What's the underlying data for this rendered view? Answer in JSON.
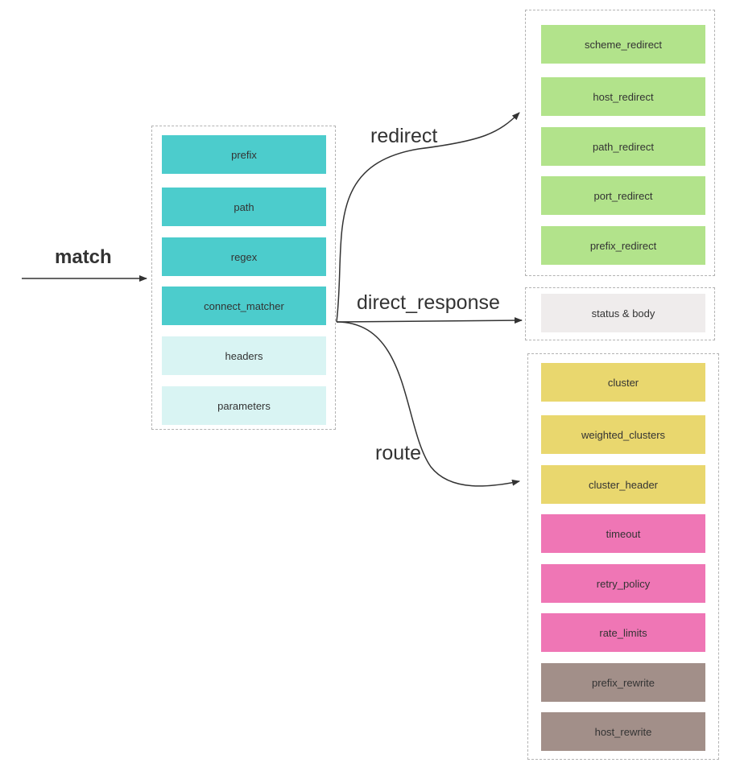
{
  "colors": {
    "teal": "#4ccccc",
    "light_teal": "#d9f4f3",
    "green": "#b2e38b",
    "gray": "#efecec",
    "yellow": "#e9d76e",
    "pink": "#ef76b5",
    "taupe": "#a28f89",
    "arrow": "#333333"
  },
  "match": {
    "label": "match",
    "items": [
      {
        "label": "prefix",
        "color": "#4ccccc"
      },
      {
        "label": "path",
        "color": "#4ccccc"
      },
      {
        "label": "regex",
        "color": "#4ccccc"
      },
      {
        "label": "connect_matcher",
        "color": "#4ccccc"
      },
      {
        "label": "headers",
        "color": "#d9f4f3"
      },
      {
        "label": "parameters",
        "color": "#d9f4f3"
      }
    ]
  },
  "edges": {
    "redirect": "redirect",
    "direct_response": "direct_response",
    "route": "route"
  },
  "redirect": {
    "items": [
      {
        "label": "scheme_redirect",
        "color": "#b2e38b"
      },
      {
        "label": "host_redirect",
        "color": "#b2e38b"
      },
      {
        "label": "path_redirect",
        "color": "#b2e38b"
      },
      {
        "label": "port_redirect",
        "color": "#b2e38b"
      },
      {
        "label": "prefix_redirect",
        "color": "#b2e38b"
      }
    ]
  },
  "direct_response": {
    "items": [
      {
        "label": "status & body",
        "color": "#efecec"
      }
    ]
  },
  "route": {
    "items": [
      {
        "label": "cluster",
        "color": "#e9d76e"
      },
      {
        "label": "weighted_clusters",
        "color": "#e9d76e"
      },
      {
        "label": "cluster_header",
        "color": "#e9d76e"
      },
      {
        "label": "timeout",
        "color": "#ef76b5"
      },
      {
        "label": "retry_policy",
        "color": "#ef76b5"
      },
      {
        "label": "rate_limits",
        "color": "#ef76b5"
      },
      {
        "label": "prefix_rewrite",
        "color": "#a28f89"
      },
      {
        "label": "host_rewrite",
        "color": "#a28f89"
      }
    ]
  }
}
